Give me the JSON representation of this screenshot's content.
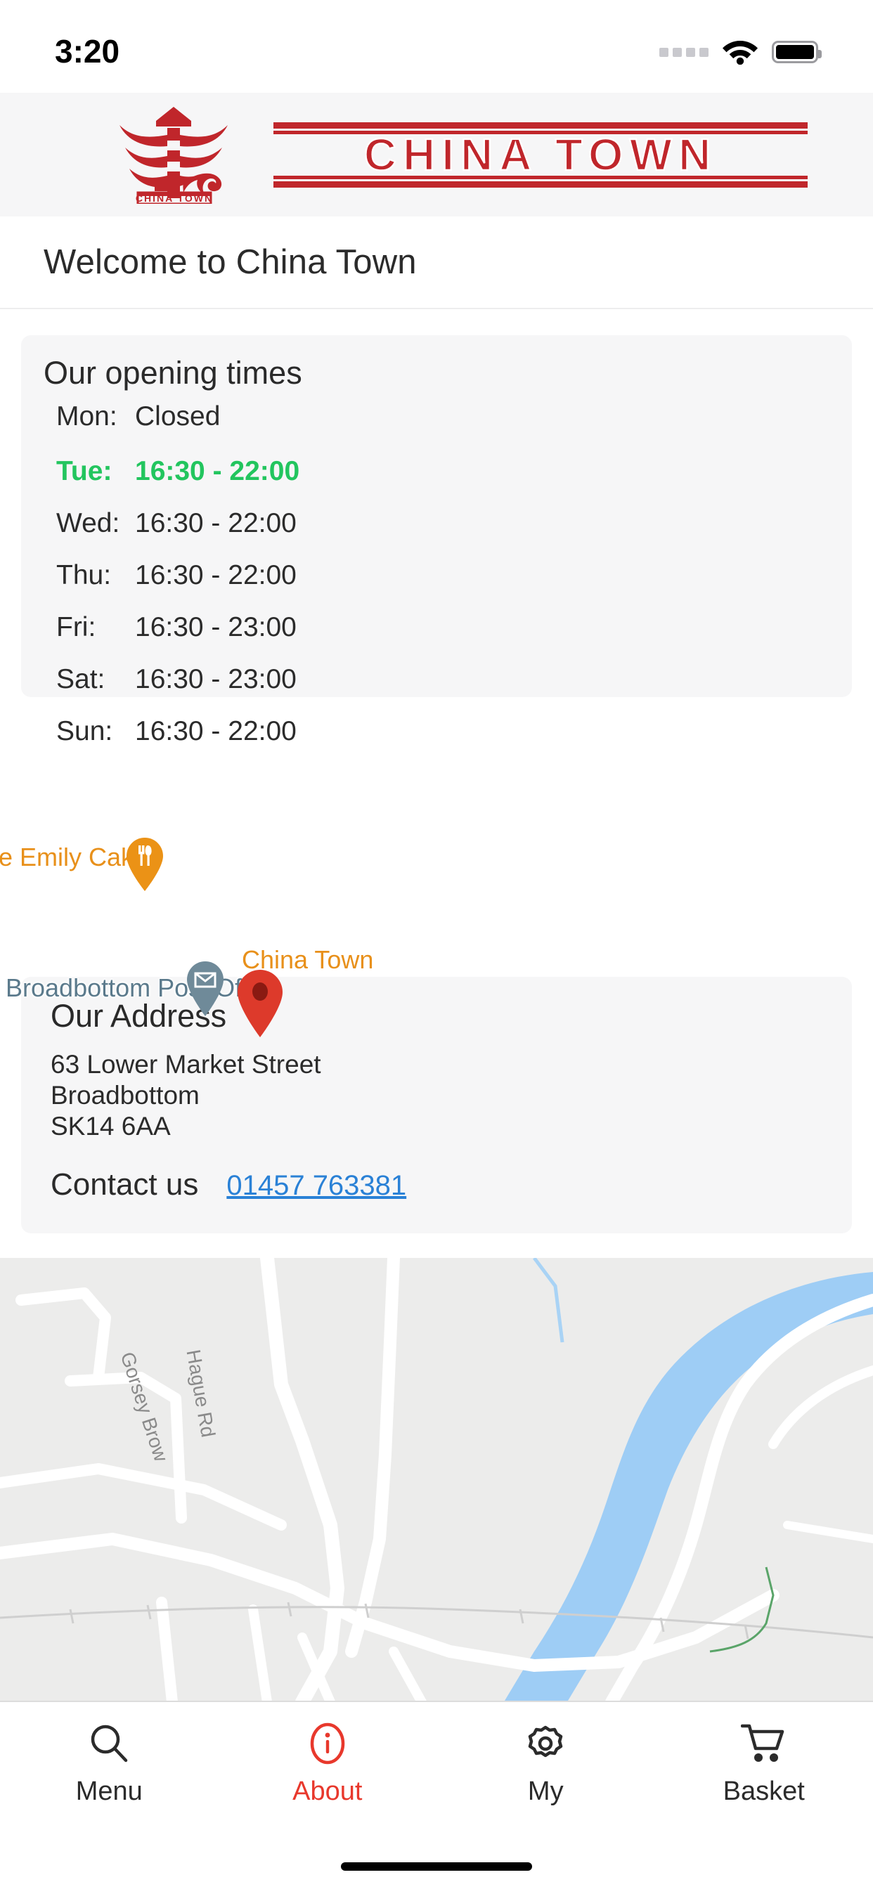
{
  "status_bar": {
    "time": "3:20",
    "signal_icon": "signal-dots",
    "wifi_icon": "wifi-icon",
    "battery_icon": "battery-full-icon"
  },
  "header": {
    "logo_mark_icon": "pagoda-logo-icon",
    "logo_mark_caption": "CHINA TOWN",
    "logo_wordmark": "CHINA TOWN"
  },
  "welcome": {
    "text": "Welcome to  China Town"
  },
  "hours": {
    "title": "Our opening times",
    "highlight_color": "#22c55e",
    "rows": [
      {
        "day": "Mon:",
        "time": "Closed",
        "today": false
      },
      {
        "day": "Tue:",
        "time": "16:30 - 22:00",
        "today": true
      },
      {
        "day": "Wed:",
        "time": "16:30 - 22:00",
        "today": false
      },
      {
        "day": "Thu:",
        "time": "16:30 - 22:00",
        "today": false
      },
      {
        "day": "Fri:",
        "time": "16:30 - 23:00",
        "today": false
      },
      {
        "day": "Sat:",
        "time": "16:30 - 23:00",
        "today": false
      },
      {
        "day": "Sun:",
        "time": "16:30 - 22:00",
        "today": false
      }
    ]
  },
  "address": {
    "title": "Our Address",
    "line1": "63 Lower Market Street",
    "line2": "Broadbottom",
    "line3": "SK14 6AA",
    "contact_label": "Contact us",
    "phone": "01457 763381",
    "phone_color": "#2a81d6"
  },
  "map": {
    "labels": {
      "cakes": "ce Emily Cakes",
      "post_office": "Broadbottom Post Office",
      "china_town": "China Town"
    },
    "roads": [
      {
        "name": "Gorsey Brow"
      },
      {
        "name": "Hague Rd"
      }
    ],
    "markers": [
      {
        "name": "restaurant-pin",
        "label": "ce Emily Cakes",
        "color": "#eb9216"
      },
      {
        "name": "post-office-pin",
        "label": "Broadbottom Post Office",
        "color": "#6f8a99"
      },
      {
        "name": "china-town-pin",
        "label": "China Town",
        "color": "#dd3a2b"
      }
    ]
  },
  "tabbar": {
    "active": "About",
    "active_color": "#e8382c",
    "items": [
      {
        "label": "Menu",
        "icon": "search-icon",
        "active": false
      },
      {
        "label": "About",
        "icon": "info-circle-icon",
        "active": true
      },
      {
        "label": "My",
        "icon": "gear-icon",
        "active": false
      },
      {
        "label": "Basket",
        "icon": "shopping-cart-icon",
        "active": false
      }
    ]
  }
}
